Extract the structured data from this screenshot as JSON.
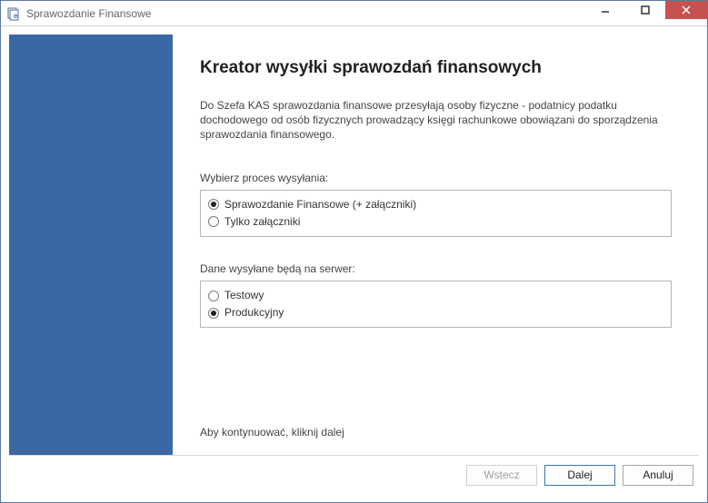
{
  "window": {
    "title": "Sprawozdanie Finansowe"
  },
  "main": {
    "title": "Kreator wysyłki sprawozdań finansowych",
    "intro": "Do Szefa KAS sprawozdania finansowe przesyłają osoby fizyczne - podatnicy podatku dochodowego od osób fizycznych prowadzący księgi rachunkowe obowiązani do sporządzenia sprawozdania finansowego.",
    "process_label": "Wybierz proces wysyłania:",
    "process_options": {
      "sprawozdanie": "Sprawozdanie Finansowe (+ załączniki)",
      "zalaczniki": "Tylko załączniki"
    },
    "process_selected": "sprawozdanie",
    "server_label": "Dane wysyłane będą na serwer:",
    "server_options": {
      "testowy": "Testowy",
      "produkcyjny": "Produkcyjny"
    },
    "server_selected": "produkcyjny",
    "continue_hint": "Aby kontynuować, kliknij dalej"
  },
  "footer": {
    "back": "Wstecz",
    "next": "Dalej",
    "cancel": "Anuluj"
  }
}
